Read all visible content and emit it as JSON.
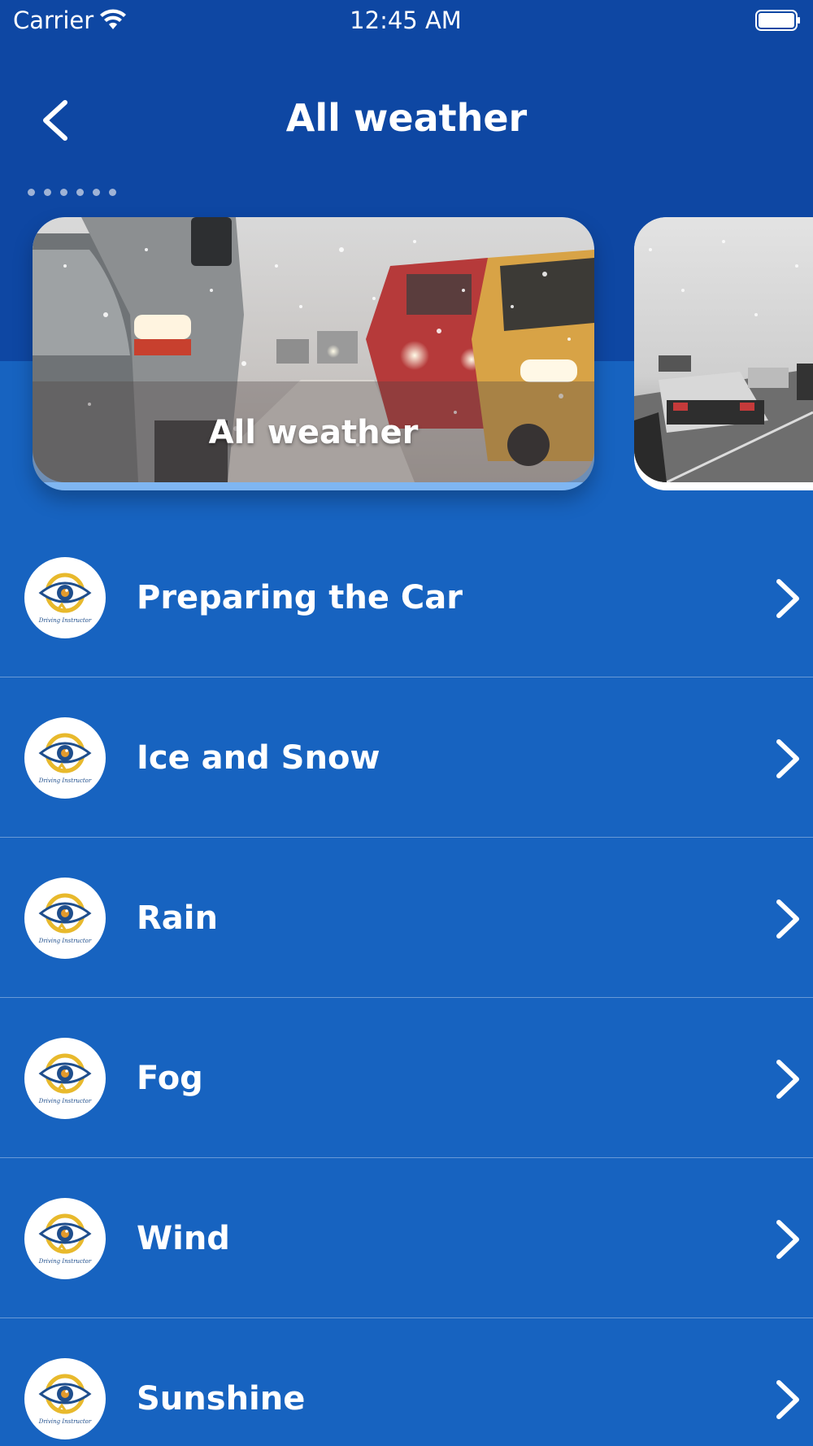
{
  "status_bar": {
    "carrier": "Carrier",
    "time": "12:45 AM",
    "icons": [
      "wifi-icon",
      "battery-icon"
    ]
  },
  "nav": {
    "title": "All weather",
    "back_icon": "chevron-left-icon"
  },
  "carousel": {
    "page_count": 6,
    "cards": [
      {
        "caption": "All weather",
        "image": "snowy-traffic-photo"
      },
      {
        "caption": "",
        "image": "snowy-highway-photo"
      }
    ]
  },
  "topics": [
    {
      "label": "Preparing the Car"
    },
    {
      "label": "Ice and Snow"
    },
    {
      "label": "Rain"
    },
    {
      "label": "Fog"
    },
    {
      "label": "Wind"
    },
    {
      "label": "Sunshine"
    }
  ],
  "logo_text": "Driving Instructor",
  "colors": {
    "header": "#0e47a3",
    "list_background": "#1763c0",
    "card_accent": "#7fb6f2",
    "logo_ring": "#e8b92c",
    "logo_eye": "#1f4e8c",
    "text": "#ffffff"
  }
}
